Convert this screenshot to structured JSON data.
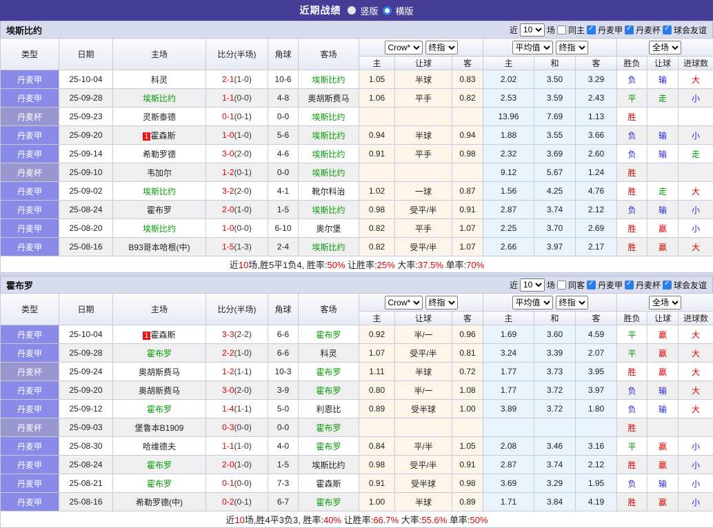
{
  "topbar": {
    "title": "近期战绩",
    "radios": [
      {
        "label": "竖版",
        "variant": "light"
      },
      {
        "label": "横版",
        "variant": "blue-ring"
      }
    ]
  },
  "columns": {
    "type": "类型",
    "date": "日期",
    "home": "主场",
    "score": "比分(半场)",
    "corner": "角球",
    "away": "客场",
    "odds": [
      "主",
      "让球",
      "客"
    ],
    "avg": [
      "主",
      "和",
      "客"
    ],
    "res": [
      "胜负",
      "让球",
      "进球数"
    ]
  },
  "colors": {
    "topbar": "#463d96",
    "league_jia": "#8a8ae8",
    "league_cup": "#9a97d0",
    "team_green": "#089b08",
    "red": "#dd0000",
    "blue": "#2424dd",
    "odds_bg": "#fdf5ea",
    "avg_bg": "#e9f3f9"
  },
  "sections": [
    {
      "team": "埃斯比约",
      "controls": {
        "prefix": "近",
        "count": "10",
        "suffix": "场",
        "same_label": "同主",
        "same_checked": false,
        "leagues": [
          {
            "label": "丹麦甲",
            "checked": true
          },
          {
            "label": "丹麦杯",
            "checked": true
          },
          {
            "label": "球会友谊",
            "checked": true
          }
        ]
      },
      "selects": {
        "company": "Crow*",
        "final1": "终指",
        "avg": "平均值",
        "final2": "终指",
        "scope": "全场"
      },
      "rows": [
        {
          "type": "丹麦甲",
          "cup": false,
          "date": "25-10-04",
          "home": {
            "name": "科灵",
            "green": false,
            "badge": ""
          },
          "score": {
            "ft": "2-1",
            "ht": "(1-0)"
          },
          "corner": "10-6",
          "away": {
            "name": "埃斯比约",
            "green": true
          },
          "odds": [
            "1.05",
            "半球",
            "0.83"
          ],
          "avg": [
            "2.02",
            "3.50",
            "3.29"
          ],
          "res": [
            [
              "负",
              "b"
            ],
            [
              "输",
              "b"
            ],
            [
              "大",
              "r"
            ]
          ]
        },
        {
          "type": "丹麦甲",
          "cup": false,
          "date": "25-09-28",
          "home": {
            "name": "埃斯比约",
            "green": true,
            "badge": ""
          },
          "score": {
            "ft": "1-1",
            "ht": "(0-0)"
          },
          "corner": "4-8",
          "away": {
            "name": "奥胡斯费马",
            "green": false
          },
          "odds": [
            "1.06",
            "平手",
            "0.82"
          ],
          "avg": [
            "2.53",
            "3.59",
            "2.43"
          ],
          "res": [
            [
              "平",
              "g"
            ],
            [
              "走",
              "g"
            ],
            [
              "小",
              "b"
            ]
          ]
        },
        {
          "type": "丹麦杯",
          "cup": true,
          "date": "25-09-23",
          "home": {
            "name": "灵斯泰德",
            "green": false,
            "badge": ""
          },
          "score": {
            "ft": "0-1",
            "ht": "(0-1)"
          },
          "corner": "0-0",
          "away": {
            "name": "埃斯比约",
            "green": true
          },
          "odds": [
            "",
            "",
            ""
          ],
          "avg": [
            "13.96",
            "7.69",
            "1.13"
          ],
          "res": [
            [
              "胜",
              "r"
            ],
            [
              "",
              ""
            ],
            [
              "",
              ""
            ]
          ]
        },
        {
          "type": "丹麦甲",
          "cup": false,
          "date": "25-09-20",
          "home": {
            "name": "霍森斯",
            "green": false,
            "badge": "1"
          },
          "score": {
            "ft": "1-0",
            "ht": "(1-0)"
          },
          "corner": "5-6",
          "away": {
            "name": "埃斯比约",
            "green": true
          },
          "odds": [
            "0.94",
            "半球",
            "0.94"
          ],
          "avg": [
            "1.88",
            "3.55",
            "3.66"
          ],
          "res": [
            [
              "负",
              "b"
            ],
            [
              "输",
              "b"
            ],
            [
              "小",
              "b"
            ]
          ]
        },
        {
          "type": "丹麦甲",
          "cup": false,
          "date": "25-09-14",
          "home": {
            "name": "希勒罗德",
            "green": false,
            "badge": ""
          },
          "score": {
            "ft": "3-0",
            "ht": "(2-0)"
          },
          "corner": "4-6",
          "away": {
            "name": "埃斯比约",
            "green": true
          },
          "odds": [
            "0.91",
            "平手",
            "0.98"
          ],
          "avg": [
            "2.32",
            "3.69",
            "2.60"
          ],
          "res": [
            [
              "负",
              "b"
            ],
            [
              "输",
              "b"
            ],
            [
              "走",
              "g"
            ]
          ]
        },
        {
          "type": "丹麦杯",
          "cup": true,
          "date": "25-09-10",
          "home": {
            "name": "韦加尔",
            "green": false,
            "badge": ""
          },
          "score": {
            "ft": "1-2",
            "ht": "(0-1)"
          },
          "corner": "0-0",
          "away": {
            "name": "埃斯比约",
            "green": true
          },
          "odds": [
            "",
            "",
            ""
          ],
          "avg": [
            "9.12",
            "5.67",
            "1.24"
          ],
          "res": [
            [
              "胜",
              "r"
            ],
            [
              "",
              ""
            ],
            [
              "",
              ""
            ]
          ]
        },
        {
          "type": "丹麦甲",
          "cup": false,
          "date": "25-09-02",
          "home": {
            "name": "埃斯比约",
            "green": true,
            "badge": ""
          },
          "score": {
            "ft": "3-2",
            "ht": "(2-0)"
          },
          "corner": "4-1",
          "away": {
            "name": "靴尔科治",
            "green": false
          },
          "odds": [
            "1.02",
            "一球",
            "0.87"
          ],
          "avg": [
            "1.56",
            "4.25",
            "4.76"
          ],
          "res": [
            [
              "胜",
              "r"
            ],
            [
              "走",
              "g"
            ],
            [
              "大",
              "r"
            ]
          ]
        },
        {
          "type": "丹麦甲",
          "cup": false,
          "date": "25-08-24",
          "home": {
            "name": "霍布罗",
            "green": false,
            "badge": ""
          },
          "score": {
            "ft": "2-0",
            "ht": "(1-0)"
          },
          "corner": "1-5",
          "away": {
            "name": "埃斯比约",
            "green": true
          },
          "odds": [
            "0.98",
            "受平/半",
            "0.91"
          ],
          "avg": [
            "2.87",
            "3.74",
            "2.12"
          ],
          "res": [
            [
              "负",
              "b"
            ],
            [
              "输",
              "b"
            ],
            [
              "小",
              "b"
            ]
          ]
        },
        {
          "type": "丹麦甲",
          "cup": false,
          "date": "25-08-20",
          "home": {
            "name": "埃斯比约",
            "green": true,
            "badge": ""
          },
          "score": {
            "ft": "1-0",
            "ht": "(0-0)"
          },
          "corner": "6-10",
          "away": {
            "name": "奥尔堡",
            "green": false
          },
          "odds": [
            "0.82",
            "平手",
            "1.07"
          ],
          "avg": [
            "2.25",
            "3.70",
            "2.69"
          ],
          "res": [
            [
              "胜",
              "r"
            ],
            [
              "赢",
              "r"
            ],
            [
              "小",
              "b"
            ]
          ]
        },
        {
          "type": "丹麦甲",
          "cup": false,
          "date": "25-08-16",
          "home": {
            "name": "B93哥本哈根(中)",
            "green": false,
            "badge": ""
          },
          "score": {
            "ft": "1-5",
            "ht": "(1-3)"
          },
          "corner": "2-4",
          "away": {
            "name": "埃斯比约",
            "green": true
          },
          "odds": [
            "0.82",
            "受平/半",
            "1.07"
          ],
          "avg": [
            "2.66",
            "3.97",
            "2.17"
          ],
          "res": [
            [
              "胜",
              "r"
            ],
            [
              "赢",
              "r"
            ],
            [
              "大",
              "r"
            ]
          ]
        }
      ],
      "summary": [
        [
          "近",
          "k"
        ],
        [
          "10",
          "r"
        ],
        [
          "场,胜5平1负4, 胜率:",
          "k"
        ],
        [
          "50%",
          "r"
        ],
        [
          " 让胜率:",
          "k"
        ],
        [
          "25%",
          "r"
        ],
        [
          " 大率:",
          "k"
        ],
        [
          "37.5%",
          "r"
        ],
        [
          " 单率:",
          "k"
        ],
        [
          "70%",
          "r"
        ]
      ]
    },
    {
      "team": "霍布罗",
      "controls": {
        "prefix": "近",
        "count": "10",
        "suffix": "场",
        "same_label": "同客",
        "same_checked": false,
        "leagues": [
          {
            "label": "丹麦甲",
            "checked": true
          },
          {
            "label": "丹麦杯",
            "checked": true
          },
          {
            "label": "球会友谊",
            "checked": true
          }
        ]
      },
      "selects": {
        "company": "Crow*",
        "final1": "终指",
        "avg": "平均值",
        "final2": "终指",
        "scope": "全场"
      },
      "rows": [
        {
          "type": "丹麦甲",
          "cup": false,
          "date": "25-10-04",
          "home": {
            "name": "霍森斯",
            "green": false,
            "badge": "1"
          },
          "score": {
            "ft": "3-3",
            "ht": "(2-2)"
          },
          "corner": "6-6",
          "away": {
            "name": "霍布罗",
            "green": true
          },
          "odds": [
            "0.92",
            "半/一",
            "0.96"
          ],
          "avg": [
            "1.69",
            "3.60",
            "4.59"
          ],
          "res": [
            [
              "平",
              "g"
            ],
            [
              "赢",
              "r"
            ],
            [
              "大",
              "r"
            ]
          ]
        },
        {
          "type": "丹麦甲",
          "cup": false,
          "date": "25-09-28",
          "home": {
            "name": "霍布罗",
            "green": true,
            "badge": ""
          },
          "score": {
            "ft": "2-2",
            "ht": "(1-0)"
          },
          "corner": "6-6",
          "away": {
            "name": "科灵",
            "green": false
          },
          "odds": [
            "1.07",
            "受平/半",
            "0.81"
          ],
          "avg": [
            "3.24",
            "3.39",
            "2.07"
          ],
          "res": [
            [
              "平",
              "g"
            ],
            [
              "赢",
              "r"
            ],
            [
              "大",
              "r"
            ]
          ]
        },
        {
          "type": "丹麦杯",
          "cup": true,
          "date": "25-09-24",
          "home": {
            "name": "奥胡斯费马",
            "green": false,
            "badge": ""
          },
          "score": {
            "ft": "1-2",
            "ht": "(1-1)"
          },
          "corner": "10-3",
          "away": {
            "name": "霍布罗",
            "green": true
          },
          "odds": [
            "1.11",
            "半球",
            "0.72"
          ],
          "avg": [
            "1.77",
            "3.73",
            "3.95"
          ],
          "res": [
            [
              "胜",
              "r"
            ],
            [
              "赢",
              "r"
            ],
            [
              "大",
              "r"
            ]
          ]
        },
        {
          "type": "丹麦甲",
          "cup": false,
          "date": "25-09-20",
          "home": {
            "name": "奥胡斯费马",
            "green": false,
            "badge": ""
          },
          "score": {
            "ft": "3-0",
            "ht": "(2-0)"
          },
          "corner": "3-9",
          "away": {
            "name": "霍布罗",
            "green": true
          },
          "odds": [
            "0.80",
            "半/一",
            "1.08"
          ],
          "avg": [
            "1.77",
            "3.72",
            "3.97"
          ],
          "res": [
            [
              "负",
              "b"
            ],
            [
              "输",
              "b"
            ],
            [
              "大",
              "r"
            ]
          ]
        },
        {
          "type": "丹麦甲",
          "cup": false,
          "date": "25-09-12",
          "home": {
            "name": "霍布罗",
            "green": true,
            "badge": ""
          },
          "score": {
            "ft": "1-4",
            "ht": "(1-1)"
          },
          "corner": "5-0",
          "away": {
            "name": "利恩比",
            "green": false
          },
          "odds": [
            "0.89",
            "受半球",
            "1.00"
          ],
          "avg": [
            "3.89",
            "3.72",
            "1.80"
          ],
          "res": [
            [
              "负",
              "b"
            ],
            [
              "输",
              "b"
            ],
            [
              "大",
              "r"
            ]
          ]
        },
        {
          "type": "丹麦杯",
          "cup": true,
          "date": "25-09-03",
          "home": {
            "name": "堡鲁本B1909",
            "green": false,
            "badge": ""
          },
          "score": {
            "ft": "0-3",
            "ht": "(0-0)"
          },
          "corner": "0-0",
          "away": {
            "name": "霍布罗",
            "green": true
          },
          "odds": [
            "",
            "",
            ""
          ],
          "avg": [
            "",
            "",
            ""
          ],
          "res": [
            [
              "胜",
              "r"
            ],
            [
              "",
              ""
            ],
            [
              "",
              ""
            ]
          ]
        },
        {
          "type": "丹麦甲",
          "cup": false,
          "date": "25-08-30",
          "home": {
            "name": "哈维德夫",
            "green": false,
            "badge": ""
          },
          "score": {
            "ft": "1-1",
            "ht": "(1-0)"
          },
          "corner": "4-0",
          "away": {
            "name": "霍布罗",
            "green": true
          },
          "odds": [
            "0.84",
            "平/半",
            "1.05"
          ],
          "avg": [
            "2.08",
            "3.46",
            "3.16"
          ],
          "res": [
            [
              "平",
              "g"
            ],
            [
              "赢",
              "r"
            ],
            [
              "小",
              "b"
            ]
          ]
        },
        {
          "type": "丹麦甲",
          "cup": false,
          "date": "25-08-24",
          "home": {
            "name": "霍布罗",
            "green": true,
            "badge": ""
          },
          "score": {
            "ft": "2-0",
            "ht": "(1-0)"
          },
          "corner": "1-5",
          "away": {
            "name": "埃斯比约",
            "green": false
          },
          "odds": [
            "0.98",
            "受平/半",
            "0.91"
          ],
          "avg": [
            "2.87",
            "3.74",
            "2.12"
          ],
          "res": [
            [
              "胜",
              "r"
            ],
            [
              "赢",
              "r"
            ],
            [
              "小",
              "b"
            ]
          ]
        },
        {
          "type": "丹麦甲",
          "cup": false,
          "date": "25-08-21",
          "home": {
            "name": "霍布罗",
            "green": true,
            "badge": ""
          },
          "score": {
            "ft": "0-1",
            "ht": "(0-0)"
          },
          "corner": "7-3",
          "away": {
            "name": "霍森斯",
            "green": false
          },
          "odds": [
            "0.91",
            "受半球",
            "0.98"
          ],
          "avg": [
            "3.69",
            "3.29",
            "1.95"
          ],
          "res": [
            [
              "负",
              "b"
            ],
            [
              "输",
              "b"
            ],
            [
              "小",
              "b"
            ]
          ]
        },
        {
          "type": "丹麦甲",
          "cup": false,
          "date": "25-08-16",
          "home": {
            "name": "希勒罗德(中)",
            "green": false,
            "badge": ""
          },
          "score": {
            "ft": "0-2",
            "ht": "(0-1)"
          },
          "corner": "6-7",
          "away": {
            "name": "霍布罗",
            "green": true
          },
          "odds": [
            "1.00",
            "半球",
            "0.89"
          ],
          "avg": [
            "1.71",
            "3.84",
            "4.19"
          ],
          "res": [
            [
              "胜",
              "r"
            ],
            [
              "赢",
              "r"
            ],
            [
              "小",
              "b"
            ]
          ]
        }
      ],
      "summary": [
        [
          "近",
          "k"
        ],
        [
          "10",
          "r"
        ],
        [
          "场,胜4平3负3, 胜率:",
          "k"
        ],
        [
          "40%",
          "r"
        ],
        [
          " 让胜率:",
          "k"
        ],
        [
          "66.7%",
          "r"
        ],
        [
          " 大率:",
          "k"
        ],
        [
          "55.6%",
          "r"
        ],
        [
          " 单率:",
          "k"
        ],
        [
          "50%",
          "r"
        ]
      ]
    }
  ]
}
